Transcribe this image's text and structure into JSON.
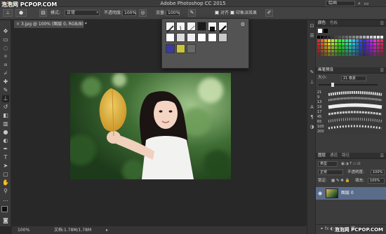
{
  "watermark": {
    "top": "泡泡网 PCPOP.COM",
    "bottom": "泡泡网 PCPOP.COM"
  },
  "app": {
    "title": "Adobe Photoshop CC 2015",
    "workspace": "绘画"
  },
  "options": {
    "mode_label": "模式:",
    "mode_value": "正常",
    "opacity_label": "不透明度:",
    "opacity_value": "100%",
    "flow_label": "流量:",
    "flow_value": "100%",
    "aligned_label": "对齐",
    "sample_label": "印象派效果"
  },
  "document": {
    "tab_label": "3.jpg @ 100% (图层 0, RGB/8) *"
  },
  "status": {
    "zoom": "100%",
    "doc": "文档:1.78M/1.78M"
  },
  "color_panel": {
    "tab_color": "颜色",
    "tab_swatches": "色板"
  },
  "brush_preset_panel": {
    "tab": "画笔预设",
    "size_label": "大小:",
    "size_value": "21 像素",
    "brush_sizes": [
      "21",
      "9",
      "13",
      "19",
      "17",
      "45",
      "65",
      "100",
      "200"
    ]
  },
  "layers_panel": {
    "tab_layers": "图层",
    "tab_channels": "通道",
    "tab_paths": "路径",
    "kind_label": "类型",
    "blend_mode": "正常",
    "opacity_label": "不透明度:",
    "opacity_value": "100%",
    "lock_label": "锁定:",
    "fill_label": "填充:",
    "fill_value": "100%",
    "layer_name": "图层 0"
  },
  "colors": {
    "accent": "#5a6c8a",
    "panel": "#3c3c3c",
    "canvas": "#282828"
  }
}
